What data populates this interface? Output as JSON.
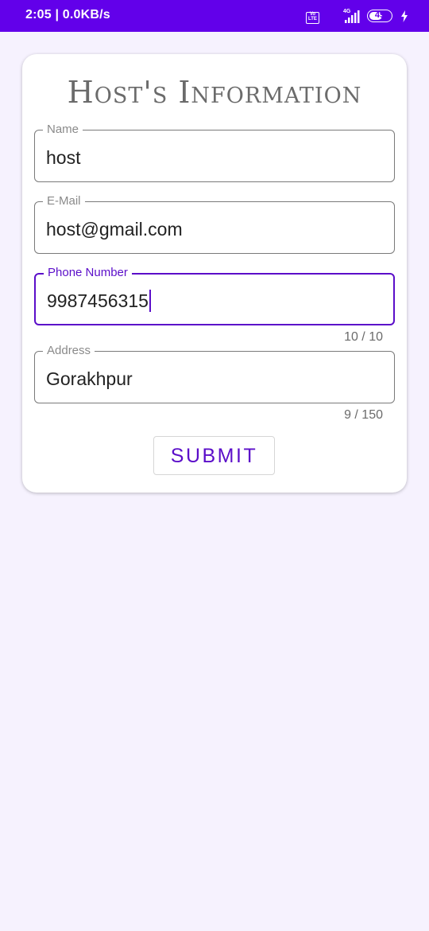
{
  "status_bar": {
    "time_speed": "2:05 | 0.0KB/s",
    "volte_label": "Vo\nLTE",
    "network_type": "4G",
    "battery_level": "49",
    "icons": [
      "volte-icon",
      "signal-icon",
      "battery-icon",
      "charging-icon"
    ]
  },
  "form": {
    "title": "Host's Information",
    "fields": [
      {
        "label": "Name",
        "value": "host"
      },
      {
        "label": "E-Mail",
        "value": "host@gmail.com"
      },
      {
        "label": "Phone Number",
        "value": "9987456315",
        "counter": "10 / 10",
        "focused": true
      },
      {
        "label": "Address",
        "value": "Gorakhpur",
        "counter": "9 / 150"
      }
    ],
    "submit_label": "SUBMIT"
  },
  "colors": {
    "accent": "#6200ea",
    "focus": "#5b0ec9",
    "background": "#f6f2fe"
  }
}
